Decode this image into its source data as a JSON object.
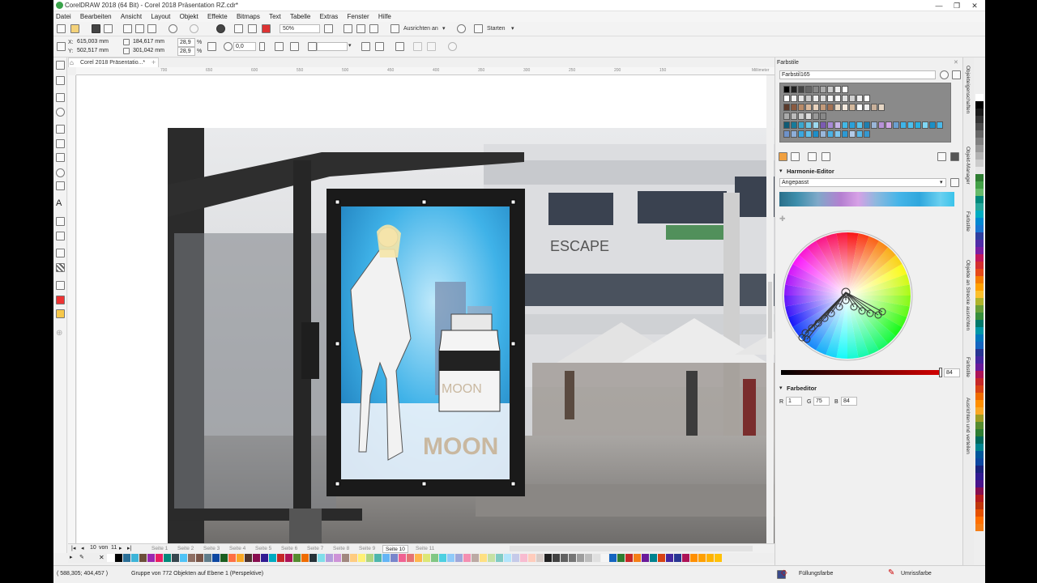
{
  "window": {
    "title": "CorelDRAW 2018 (64 Bit) - Corel 2018 Präsentation RZ.cdr*",
    "min_label": "—",
    "max_label": "❐",
    "close_label": "✕"
  },
  "menu": {
    "items": [
      "Datei",
      "Bearbeiten",
      "Ansicht",
      "Layout",
      "Objekt",
      "Effekte",
      "Bitmaps",
      "Text",
      "Tabelle",
      "Extras",
      "Fenster",
      "Hilfe"
    ]
  },
  "toolbar": {
    "zoom_value": "50%",
    "align_label": "Ausrichten an",
    "start_label": "Starten"
  },
  "property_bar": {
    "x_label": "X:",
    "x_value": "615,003 mm",
    "y_label": "Y:",
    "y_value": "502,517 mm",
    "width_value": "184,617 mm",
    "height_value": "301,042 mm",
    "scale_x": "28,9",
    "scale_y": "28,9",
    "percent": "%",
    "rotation": "0,0"
  },
  "document": {
    "tab_label": "Corel 2018 Präsentatio...*",
    "ruler_unit": "Millimeter",
    "ruler_ticks": [
      "700",
      "650",
      "600",
      "550",
      "500",
      "450",
      "400",
      "350",
      "300",
      "250",
      "200",
      "150",
      "100",
      "50",
      "0"
    ],
    "poster_text_bottle": "MOON",
    "poster_text_big": "MOON",
    "sign_text": "ESCAPE"
  },
  "pages": {
    "current": "10",
    "of": "von",
    "total": "11",
    "tabs": [
      "Seite 1",
      "Seite 2",
      "Seite 3",
      "Seite 4",
      "Seite 5",
      "Seite 6",
      "Seite 7",
      "Seite 8",
      "Seite 9",
      "Seite 10",
      "Seite 11"
    ],
    "active_index": 9
  },
  "status": {
    "coords": "( 588,305; 404,457 )",
    "message": "Gruppe von 772 Objekten auf Ebene 1  (Perspektive)",
    "fill_label": "Füllungsfarbe",
    "outline_label": "Umrissfarbe"
  },
  "docker": {
    "title": "Farbstile",
    "style_name": "Farbstil165",
    "harmony_title": "Harmonie-Editor",
    "harmony_mode": "Angepasst",
    "slider_value": "84",
    "color_editor_title": "Farbeditor",
    "r_label": "R",
    "r_value": "1",
    "g_label": "G",
    "g_value": "75",
    "b_label": "B",
    "b_value": "84"
  },
  "side_tabs": [
    "Objekteigenschaften",
    "Objekt-Manager",
    "Farbstile",
    "Objekte an Strecke ausrichten",
    "Farbstile",
    "Ausrichten und verteilen"
  ],
  "colors": {
    "accent": "#2f6fb5",
    "selection": "#1a5fa8",
    "slider_red": "#c00000"
  },
  "bottom_palette": [
    "#ffffff",
    "#000000",
    "#2a6f97",
    "#3cb4d8",
    "#6b4f3a",
    "#9c27b0",
    "#e91e63",
    "#00897b",
    "#37474f",
    "#4fc3f7",
    "#8d6e63",
    "#795548",
    "#607d8b",
    "#0d47a1",
    "#1b5e20",
    "#ff7043",
    "#f9a825",
    "#4e342e",
    "#880e4f",
    "#311b92",
    "#00acc1",
    "#c62828",
    "#ad1457",
    "#558b2f",
    "#ef6c00",
    "#263238",
    "#80deea",
    "#b39ddb",
    "#ce93d8",
    "#a1887f",
    "#ffcc80",
    "#fff176",
    "#aed581",
    "#4db6ac",
    "#64b5f6",
    "#7986cb",
    "#f06292",
    "#e57373",
    "#ffb74d",
    "#dce775",
    "#81c784",
    "#4dd0e1",
    "#90caf9",
    "#9fa8da",
    "#f48fb1",
    "#bcaaa4",
    "#ffe082",
    "#c5e1a5",
    "#80cbc4",
    "#b3e5fc",
    "#c5cae9",
    "#f8bbd0",
    "#ffccbc",
    "#d7ccc8",
    "#212121",
    "#424242",
    "#616161",
    "#757575",
    "#9e9e9e",
    "#bdbdbd",
    "#e0e0e0",
    "#f5f5f5",
    "#1565c0",
    "#2e7d32",
    "#c62828",
    "#f57f17",
    "#6a1b9a",
    "#00838f",
    "#d84315",
    "#4527a0",
    "#283593",
    "#ad1457",
    "#ff8f00",
    "#ffa000",
    "#ffb300",
    "#ffc107"
  ],
  "right_palette": [
    "#ffffff",
    "#000000",
    "#1a1a1a",
    "#333333",
    "#4d4d4d",
    "#666666",
    "#808080",
    "#999999",
    "#b3b3b3",
    "#cccccc",
    "#e6e6e6",
    "#2e7d32",
    "#43a047",
    "#66bb6a",
    "#00897b",
    "#26a69a",
    "#00acc1",
    "#0288d1",
    "#1976d2",
    "#303f9f",
    "#512da8",
    "#7b1fa2",
    "#c2185b",
    "#d32f2f",
    "#e64a19",
    "#f57c00",
    "#ffa000",
    "#fbc02d",
    "#afb42b",
    "#689f38",
    "#388e3c",
    "#00796b",
    "#0097a7",
    "#0277bd",
    "#1565c0",
    "#283593",
    "#4527a0",
    "#6a1b9a",
    "#ad1457",
    "#c62828",
    "#d84315",
    "#ef6c00",
    "#ff8f00",
    "#f9a825",
    "#9e9d24",
    "#558b2f",
    "#2e7d32",
    "#00695c",
    "#00838f",
    "#01579b",
    "#0d47a1",
    "#1a237e",
    "#311b92",
    "#4a148c",
    "#880e4f",
    "#b71c1c",
    "#bf360c",
    "#e65100",
    "#ff6f00",
    "#f57f17"
  ]
}
